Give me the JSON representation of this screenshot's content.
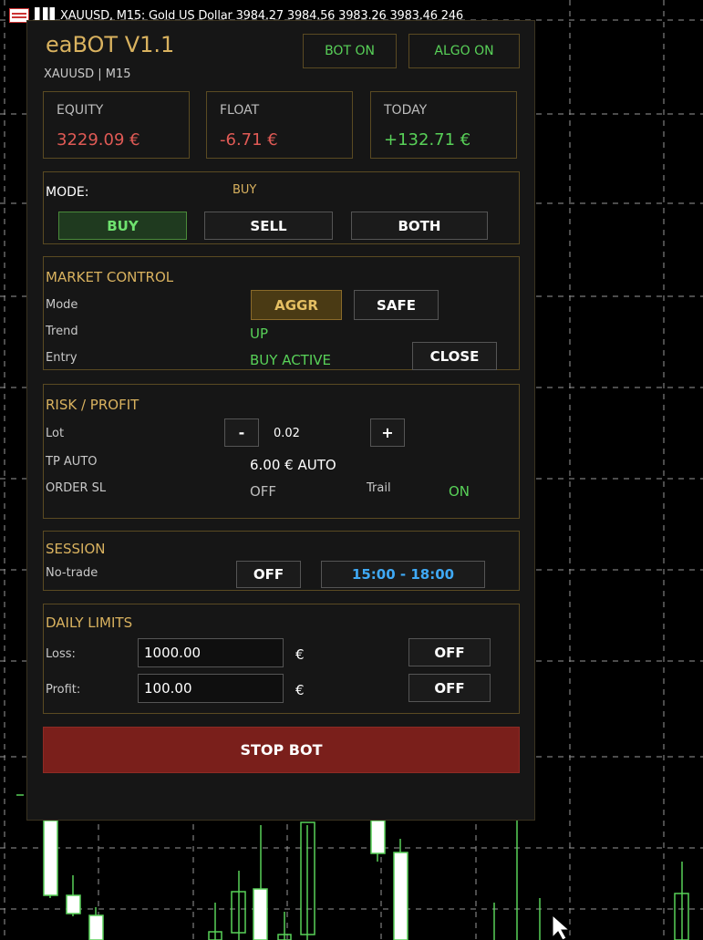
{
  "chart_header": {
    "text": "XAUUSD, M15:  Gold US Dollar  3984.27 3984.56 3983.26 3983.46  246"
  },
  "panel": {
    "title": "eaBOT V1.1",
    "subtitle": "XAUUSD | M15",
    "bot_status": "BOT ON",
    "algo_status": "ALGO ON",
    "stats": {
      "equity_label": "EQUITY",
      "equity_value": "3229.09 €",
      "float_label": "FLOAT",
      "float_value": "-6.71 €",
      "today_label": "TODAY",
      "today_value": "+132.71 €"
    },
    "mode": {
      "label": "MODE:",
      "current": "BUY",
      "buy": "BUY",
      "sell": "SELL",
      "both": "BOTH"
    },
    "market": {
      "title": "MARKET CONTROL",
      "mode_label": "Mode",
      "aggr": "AGGR",
      "safe": "SAFE",
      "trend_label": "Trend",
      "trend_value": "UP",
      "entry_label": "Entry",
      "entry_value": "BUY ACTIVE",
      "close": "CLOSE"
    },
    "risk": {
      "title": "RISK / PROFIT",
      "lot_label": "Lot",
      "minus": "-",
      "lot_value": "0.02",
      "plus": "+",
      "tp_label": "TP AUTO",
      "tp_value": "6.00 € AUTO",
      "sl_label": "ORDER SL",
      "sl_value": "OFF",
      "trail_label": "Trail",
      "trail_value": "ON"
    },
    "session": {
      "title": "SESSION",
      "notrade_label": "No-trade",
      "off": "OFF",
      "time_range": "15:00 - 18:00"
    },
    "limits": {
      "title": "DAILY LIMITS",
      "loss_label": "Loss:",
      "loss_value": "1000.00",
      "loss_currency": "€",
      "loss_toggle": "OFF",
      "profit_label": "Profit:",
      "profit_value": "100.00",
      "profit_currency": "€",
      "profit_toggle": "OFF"
    },
    "stop_button": "STOP BOT"
  },
  "colors": {
    "accent_gold": "#d9b25f",
    "positive": "#58d158",
    "negative": "#e05a55",
    "stop": "#7a1f1b",
    "time": "#3fa9f5"
  }
}
